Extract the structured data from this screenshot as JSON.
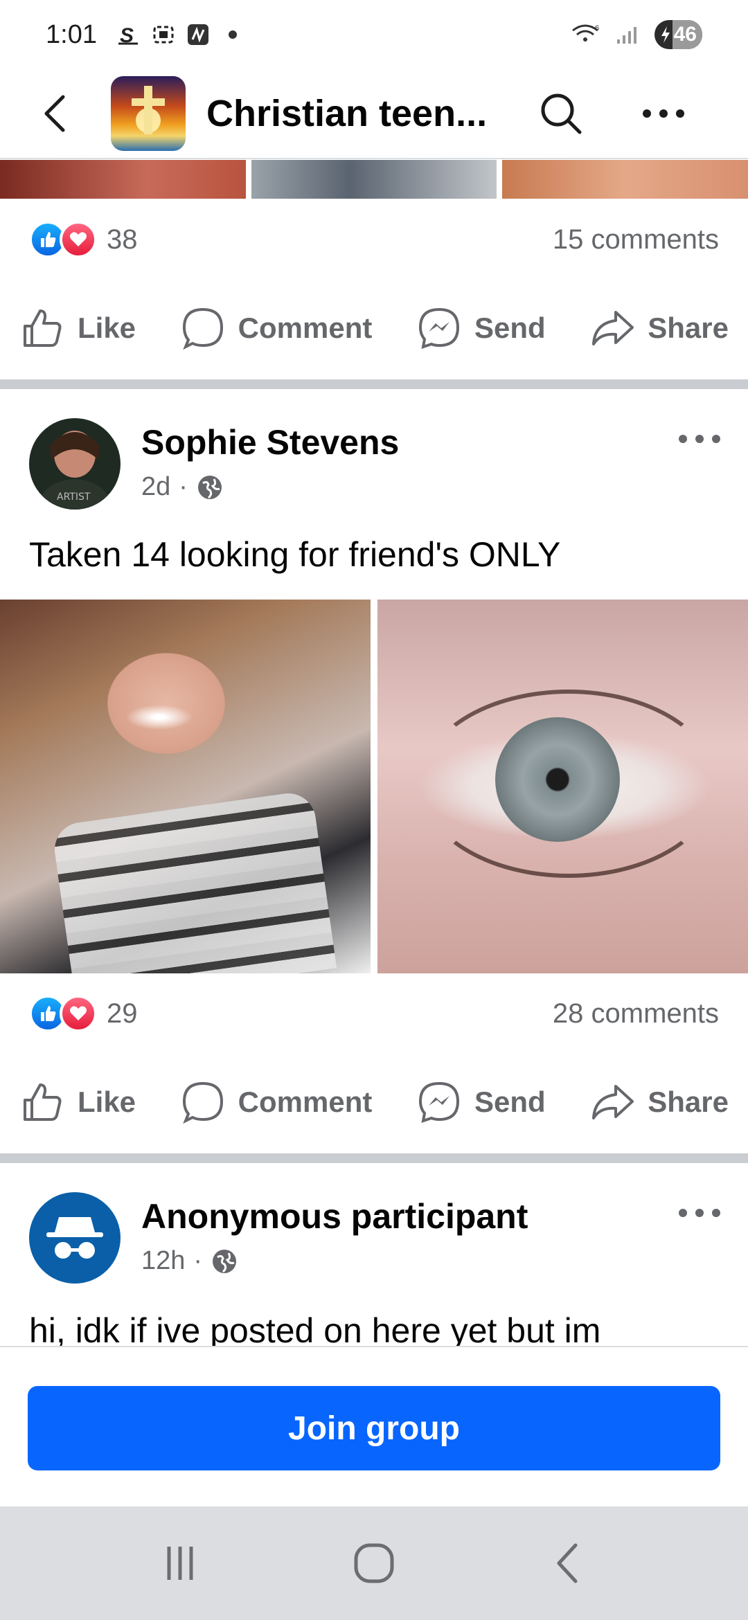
{
  "status_bar": {
    "time": "1:01",
    "battery": "46"
  },
  "header": {
    "group_title": "Christian teen..."
  },
  "post1": {
    "reaction_count": "38",
    "comments": "15 comments"
  },
  "actions": {
    "like": "Like",
    "comment": "Comment",
    "send": "Send",
    "share": "Share"
  },
  "post2": {
    "author": "Sophie Stevens",
    "time": "2d",
    "text": "Taken 14 looking for friend's ONLY",
    "reaction_count": "29",
    "comments": "28 comments"
  },
  "post3": {
    "author": "Anonymous participant",
    "time": "12h",
    "text": "hi, idk if ive posted on here yet but im"
  },
  "join_button": "Join group",
  "colors": {
    "accent": "#0866ff",
    "like": "#0a66e2",
    "love": "#e61e3c"
  },
  "icons": [
    "back-arrow-icon",
    "search-icon",
    "more-icon",
    "globe-icon",
    "like-icon",
    "comment-icon",
    "messenger-icon",
    "share-icon",
    "incognito-icon"
  ]
}
